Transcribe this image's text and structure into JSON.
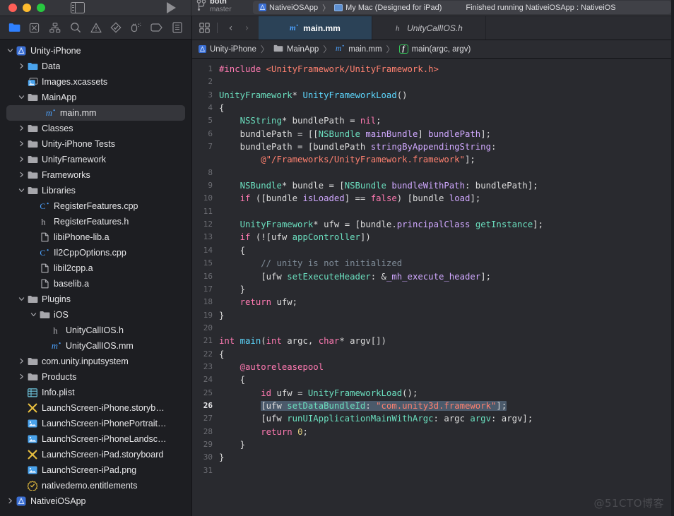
{
  "window": {
    "traffic_lights": [
      "close",
      "minimize",
      "zoom"
    ],
    "panel_toggle_icon": "sidebar-toggle-icon",
    "run_icon": "run-play-icon"
  },
  "branch": {
    "icon": "source-control-branch-icon",
    "name": "both",
    "sub": "master"
  },
  "status": {
    "scheme_icon": "app-scheme-icon",
    "scheme": "NativeiOSApp",
    "separator": "〉",
    "destination_icon": "mac-display-icon",
    "destination": "My Mac (Designed for iPad)",
    "message": "Finished running NativeiOSApp : NativeiOS"
  },
  "navigator": {
    "toolbar_icons": [
      {
        "name": "project-navigator-icon",
        "active": true
      },
      {
        "name": "source-control-navigator-icon",
        "active": false
      },
      {
        "name": "symbol-navigator-icon",
        "active": false
      },
      {
        "name": "find-navigator-icon",
        "active": false
      },
      {
        "name": "issue-navigator-icon",
        "active": false
      },
      {
        "name": "test-navigator-icon",
        "active": false
      },
      {
        "name": "debug-navigator-icon",
        "active": false
      },
      {
        "name": "breakpoint-navigator-icon",
        "active": false
      },
      {
        "name": "report-navigator-icon",
        "active": false
      }
    ],
    "tree": [
      {
        "label": "Unity-iPhone",
        "depth": 0,
        "icon": "project-icon",
        "disc": "open",
        "selected": false
      },
      {
        "label": "Data",
        "depth": 1,
        "icon": "folder-blue-icon",
        "disc": "closed",
        "selected": false
      },
      {
        "label": "Images.xcassets",
        "depth": 1,
        "icon": "assets-icon",
        "disc": "none",
        "selected": false
      },
      {
        "label": "MainApp",
        "depth": 1,
        "icon": "folder-gray-icon",
        "disc": "open",
        "selected": false
      },
      {
        "label": "main.mm",
        "depth": 2,
        "icon": "objcpp-icon",
        "disc": "none",
        "selected": true
      },
      {
        "label": "Classes",
        "depth": 1,
        "icon": "folder-gray-icon",
        "disc": "closed",
        "selected": false
      },
      {
        "label": "Unity-iPhone Tests",
        "depth": 1,
        "icon": "folder-gray-icon",
        "disc": "closed",
        "selected": false
      },
      {
        "label": "UnityFramework",
        "depth": 1,
        "icon": "folder-gray-icon",
        "disc": "closed",
        "selected": false
      },
      {
        "label": "Frameworks",
        "depth": 1,
        "icon": "folder-gray-icon",
        "disc": "closed",
        "selected": false
      },
      {
        "label": "Libraries",
        "depth": 1,
        "icon": "folder-gray-icon",
        "disc": "open",
        "selected": false
      },
      {
        "label": "RegisterFeatures.cpp",
        "depth": 2,
        "icon": "cpp-icon",
        "disc": "none",
        "selected": false
      },
      {
        "label": "RegisterFeatures.h",
        "depth": 2,
        "icon": "header-icon",
        "disc": "none",
        "selected": false
      },
      {
        "label": "libiPhone-lib.a",
        "depth": 2,
        "icon": "file-icon",
        "disc": "none",
        "selected": false
      },
      {
        "label": "Il2CppOptions.cpp",
        "depth": 2,
        "icon": "cpp-icon",
        "disc": "none",
        "selected": false
      },
      {
        "label": "libil2cpp.a",
        "depth": 2,
        "icon": "file-icon",
        "disc": "none",
        "selected": false
      },
      {
        "label": "baselib.a",
        "depth": 2,
        "icon": "file-icon",
        "disc": "none",
        "selected": false
      },
      {
        "label": "Plugins",
        "depth": 1,
        "icon": "folder-gray-icon",
        "disc": "open",
        "selected": false
      },
      {
        "label": "iOS",
        "depth": 2,
        "icon": "folder-gray-icon",
        "disc": "open",
        "selected": false
      },
      {
        "label": "UnityCallIOS.h",
        "depth": 3,
        "icon": "header-icon",
        "disc": "none",
        "selected": false
      },
      {
        "label": "UnityCallIOS.mm",
        "depth": 3,
        "icon": "objcpp-icon",
        "disc": "none",
        "selected": false
      },
      {
        "label": "com.unity.inputsystem",
        "depth": 1,
        "icon": "folder-gray-icon",
        "disc": "closed",
        "selected": false
      },
      {
        "label": "Products",
        "depth": 1,
        "icon": "folder-gray-icon",
        "disc": "closed",
        "selected": false
      },
      {
        "label": "Info.plist",
        "depth": 1,
        "icon": "plist-icon",
        "disc": "none",
        "selected": false
      },
      {
        "label": "LaunchScreen-iPhone.storyb…",
        "depth": 1,
        "icon": "storyboard-icon",
        "disc": "none",
        "selected": false
      },
      {
        "label": "LaunchScreen-iPhonePortrait…",
        "depth": 1,
        "icon": "image-icon",
        "disc": "none",
        "selected": false
      },
      {
        "label": "LaunchScreen-iPhoneLandsc…",
        "depth": 1,
        "icon": "image-icon",
        "disc": "none",
        "selected": false
      },
      {
        "label": "LaunchScreen-iPad.storyboard",
        "depth": 1,
        "icon": "storyboard-icon",
        "disc": "none",
        "selected": false
      },
      {
        "label": "LaunchScreen-iPad.png",
        "depth": 1,
        "icon": "image-icon",
        "disc": "none",
        "selected": false
      },
      {
        "label": "nativedemo.entitlements",
        "depth": 1,
        "icon": "entitlements-icon",
        "disc": "none",
        "selected": false
      },
      {
        "label": "NativeiOSApp",
        "depth": 0,
        "icon": "project-icon",
        "disc": "closed",
        "selected": false
      }
    ]
  },
  "tabbar": {
    "grid_icon": "tab-overview-icon",
    "back_label": "‹",
    "forward_label": "›",
    "tabs": [
      {
        "label": "main.mm",
        "icon": "objcpp-icon",
        "active": true
      },
      {
        "label": "UnityCallIOS.h",
        "icon": "header-icon",
        "active": false
      }
    ]
  },
  "breadcrumb": {
    "items": [
      {
        "label": "Unity-iPhone",
        "icon": "project-icon"
      },
      {
        "label": "MainApp",
        "icon": "folder-gray-icon"
      },
      {
        "label": "main.mm",
        "icon": "objcpp-icon"
      },
      {
        "label": "main(argc, argv)",
        "icon": "function-badge-icon"
      }
    ],
    "separator": "〉"
  },
  "editor": {
    "current_line": 26,
    "selection_line": 26,
    "lines": [
      {
        "n": 1,
        "tokens": [
          {
            "t": "#include ",
            "c": "k-pre"
          },
          {
            "t": "<UnityFramework/UnityFramework.h>",
            "c": "k-str"
          }
        ]
      },
      {
        "n": 2,
        "tokens": []
      },
      {
        "n": 3,
        "tokens": [
          {
            "t": "UnityFramework",
            "c": "k-type"
          },
          {
            "t": "* ",
            "c": "k-plain"
          },
          {
            "t": "UnityFrameworkLoad",
            "c": "k-fn"
          },
          {
            "t": "()",
            "c": "k-plain"
          }
        ]
      },
      {
        "n": 4,
        "tokens": [
          {
            "t": "{",
            "c": "k-plain"
          }
        ]
      },
      {
        "n": 5,
        "tokens": [
          {
            "t": "    ",
            "c": "k-plain"
          },
          {
            "t": "NSString",
            "c": "k-type"
          },
          {
            "t": "* bundlePath = ",
            "c": "k-plain"
          },
          {
            "t": "nil",
            "c": "k-kw"
          },
          {
            "t": ";",
            "c": "k-plain"
          }
        ]
      },
      {
        "n": 6,
        "tokens": [
          {
            "t": "    bundlePath = [[",
            "c": "k-plain"
          },
          {
            "t": "NSBundle",
            "c": "k-type"
          },
          {
            "t": " ",
            "c": "k-plain"
          },
          {
            "t": "mainBundle",
            "c": "k-prop"
          },
          {
            "t": "] ",
            "c": "k-plain"
          },
          {
            "t": "bundlePath",
            "c": "k-prop"
          },
          {
            "t": "];",
            "c": "k-plain"
          }
        ]
      },
      {
        "n": 7,
        "tokens": [
          {
            "t": "    bundlePath = [bundlePath ",
            "c": "k-plain"
          },
          {
            "t": "stringByAppendingString",
            "c": "k-prop"
          },
          {
            "t": ":",
            "c": "k-plain"
          }
        ]
      },
      {
        "n": 0,
        "tokens": [
          {
            "t": "        ",
            "c": "k-plain"
          },
          {
            "t": "@\"/Frameworks/UnityFramework.framework\"",
            "c": "k-str"
          },
          {
            "t": "];",
            "c": "k-plain"
          }
        ]
      },
      {
        "n": 8,
        "tokens": []
      },
      {
        "n": 9,
        "tokens": [
          {
            "t": "    ",
            "c": "k-plain"
          },
          {
            "t": "NSBundle",
            "c": "k-type"
          },
          {
            "t": "* bundle = [",
            "c": "k-plain"
          },
          {
            "t": "NSBundle",
            "c": "k-type"
          },
          {
            "t": " ",
            "c": "k-plain"
          },
          {
            "t": "bundleWithPath",
            "c": "k-prop"
          },
          {
            "t": ": bundlePath];",
            "c": "k-plain"
          }
        ]
      },
      {
        "n": 10,
        "tokens": [
          {
            "t": "    ",
            "c": "k-plain"
          },
          {
            "t": "if",
            "c": "k-kw"
          },
          {
            "t": " ([bundle ",
            "c": "k-plain"
          },
          {
            "t": "isLoaded",
            "c": "k-prop"
          },
          {
            "t": "] == ",
            "c": "k-plain"
          },
          {
            "t": "false",
            "c": "k-kw"
          },
          {
            "t": ") [bundle ",
            "c": "k-plain"
          },
          {
            "t": "load",
            "c": "k-prop"
          },
          {
            "t": "];",
            "c": "k-plain"
          }
        ]
      },
      {
        "n": 11,
        "tokens": []
      },
      {
        "n": 12,
        "tokens": [
          {
            "t": "    ",
            "c": "k-plain"
          },
          {
            "t": "UnityFramework",
            "c": "k-type"
          },
          {
            "t": "* ufw = [bundle.",
            "c": "k-plain"
          },
          {
            "t": "principalClass",
            "c": "k-prop"
          },
          {
            "t": " ",
            "c": "k-plain"
          },
          {
            "t": "getInstance",
            "c": "k-call"
          },
          {
            "t": "];",
            "c": "k-plain"
          }
        ]
      },
      {
        "n": 13,
        "tokens": [
          {
            "t": "    ",
            "c": "k-plain"
          },
          {
            "t": "if",
            "c": "k-kw"
          },
          {
            "t": " (![ufw ",
            "c": "k-plain"
          },
          {
            "t": "appController",
            "c": "k-call"
          },
          {
            "t": "])",
            "c": "k-plain"
          }
        ]
      },
      {
        "n": 14,
        "tokens": [
          {
            "t": "    {",
            "c": "k-plain"
          }
        ]
      },
      {
        "n": 15,
        "tokens": [
          {
            "t": "        ",
            "c": "k-plain"
          },
          {
            "t": "// unity is not initialized",
            "c": "k-cmt"
          }
        ]
      },
      {
        "n": 16,
        "tokens": [
          {
            "t": "        [ufw ",
            "c": "k-plain"
          },
          {
            "t": "setExecuteHeader",
            "c": "k-call"
          },
          {
            "t": ": &",
            "c": "k-plain"
          },
          {
            "t": "_mh_execute_header",
            "c": "k-prop"
          },
          {
            "t": "];",
            "c": "k-plain"
          }
        ]
      },
      {
        "n": 17,
        "tokens": [
          {
            "t": "    }",
            "c": "k-plain"
          }
        ]
      },
      {
        "n": 18,
        "tokens": [
          {
            "t": "    ",
            "c": "k-plain"
          },
          {
            "t": "return",
            "c": "k-kw"
          },
          {
            "t": " ufw;",
            "c": "k-plain"
          }
        ]
      },
      {
        "n": 19,
        "tokens": [
          {
            "t": "}",
            "c": "k-plain"
          }
        ]
      },
      {
        "n": 20,
        "tokens": []
      },
      {
        "n": 21,
        "tokens": [
          {
            "t": "int",
            "c": "k-kw"
          },
          {
            "t": " ",
            "c": "k-plain"
          },
          {
            "t": "main",
            "c": "k-fn"
          },
          {
            "t": "(",
            "c": "k-plain"
          },
          {
            "t": "int",
            "c": "k-kw"
          },
          {
            "t": " argc, ",
            "c": "k-plain"
          },
          {
            "t": "char",
            "c": "k-kw"
          },
          {
            "t": "* argv[])",
            "c": "k-plain"
          }
        ]
      },
      {
        "n": 22,
        "tokens": [
          {
            "t": "{",
            "c": "k-plain"
          }
        ]
      },
      {
        "n": 23,
        "tokens": [
          {
            "t": "    ",
            "c": "k-plain"
          },
          {
            "t": "@autoreleasepool",
            "c": "k-kw"
          }
        ]
      },
      {
        "n": 24,
        "tokens": [
          {
            "t": "    {",
            "c": "k-plain"
          }
        ]
      },
      {
        "n": 25,
        "tokens": [
          {
            "t": "        ",
            "c": "k-plain"
          },
          {
            "t": "id",
            "c": "k-kw"
          },
          {
            "t": " ufw = ",
            "c": "k-plain"
          },
          {
            "t": "UnityFrameworkLoad",
            "c": "k-call"
          },
          {
            "t": "();",
            "c": "k-plain"
          }
        ]
      },
      {
        "n": 26,
        "selected": true,
        "indent": "        ",
        "tokens": [
          {
            "t": "[ufw ",
            "c": "k-plain"
          },
          {
            "t": "setDataBundleId",
            "c": "k-call"
          },
          {
            "t": ": ",
            "c": "k-plain"
          },
          {
            "t": "\"com.unity3d.framework\"",
            "c": "k-str"
          },
          {
            "t": "];",
            "c": "k-plain"
          }
        ]
      },
      {
        "n": 27,
        "tokens": [
          {
            "t": "        [ufw ",
            "c": "k-plain"
          },
          {
            "t": "runUIApplicationMainWithArgc",
            "c": "k-call"
          },
          {
            "t": ": argc ",
            "c": "k-plain"
          },
          {
            "t": "argv",
            "c": "k-call"
          },
          {
            "t": ": argv];",
            "c": "k-plain"
          }
        ]
      },
      {
        "n": 28,
        "tokens": [
          {
            "t": "        ",
            "c": "k-plain"
          },
          {
            "t": "return",
            "c": "k-kw"
          },
          {
            "t": " ",
            "c": "k-plain"
          },
          {
            "t": "0",
            "c": "k-num"
          },
          {
            "t": ";",
            "c": "k-plain"
          }
        ]
      },
      {
        "n": 29,
        "tokens": [
          {
            "t": "    }",
            "c": "k-plain"
          }
        ]
      },
      {
        "n": 30,
        "tokens": [
          {
            "t": "}",
            "c": "k-plain"
          }
        ]
      },
      {
        "n": 31,
        "tokens": []
      }
    ]
  },
  "watermark": {
    "text": "@51CTO博客"
  },
  "colors": {
    "accent": "#2b4257",
    "sidebar_bg": "#1d1e22",
    "editor_bg": "#292a2f",
    "chrome_bg": "#2b2c31",
    "selection": "#4b5a6b"
  }
}
